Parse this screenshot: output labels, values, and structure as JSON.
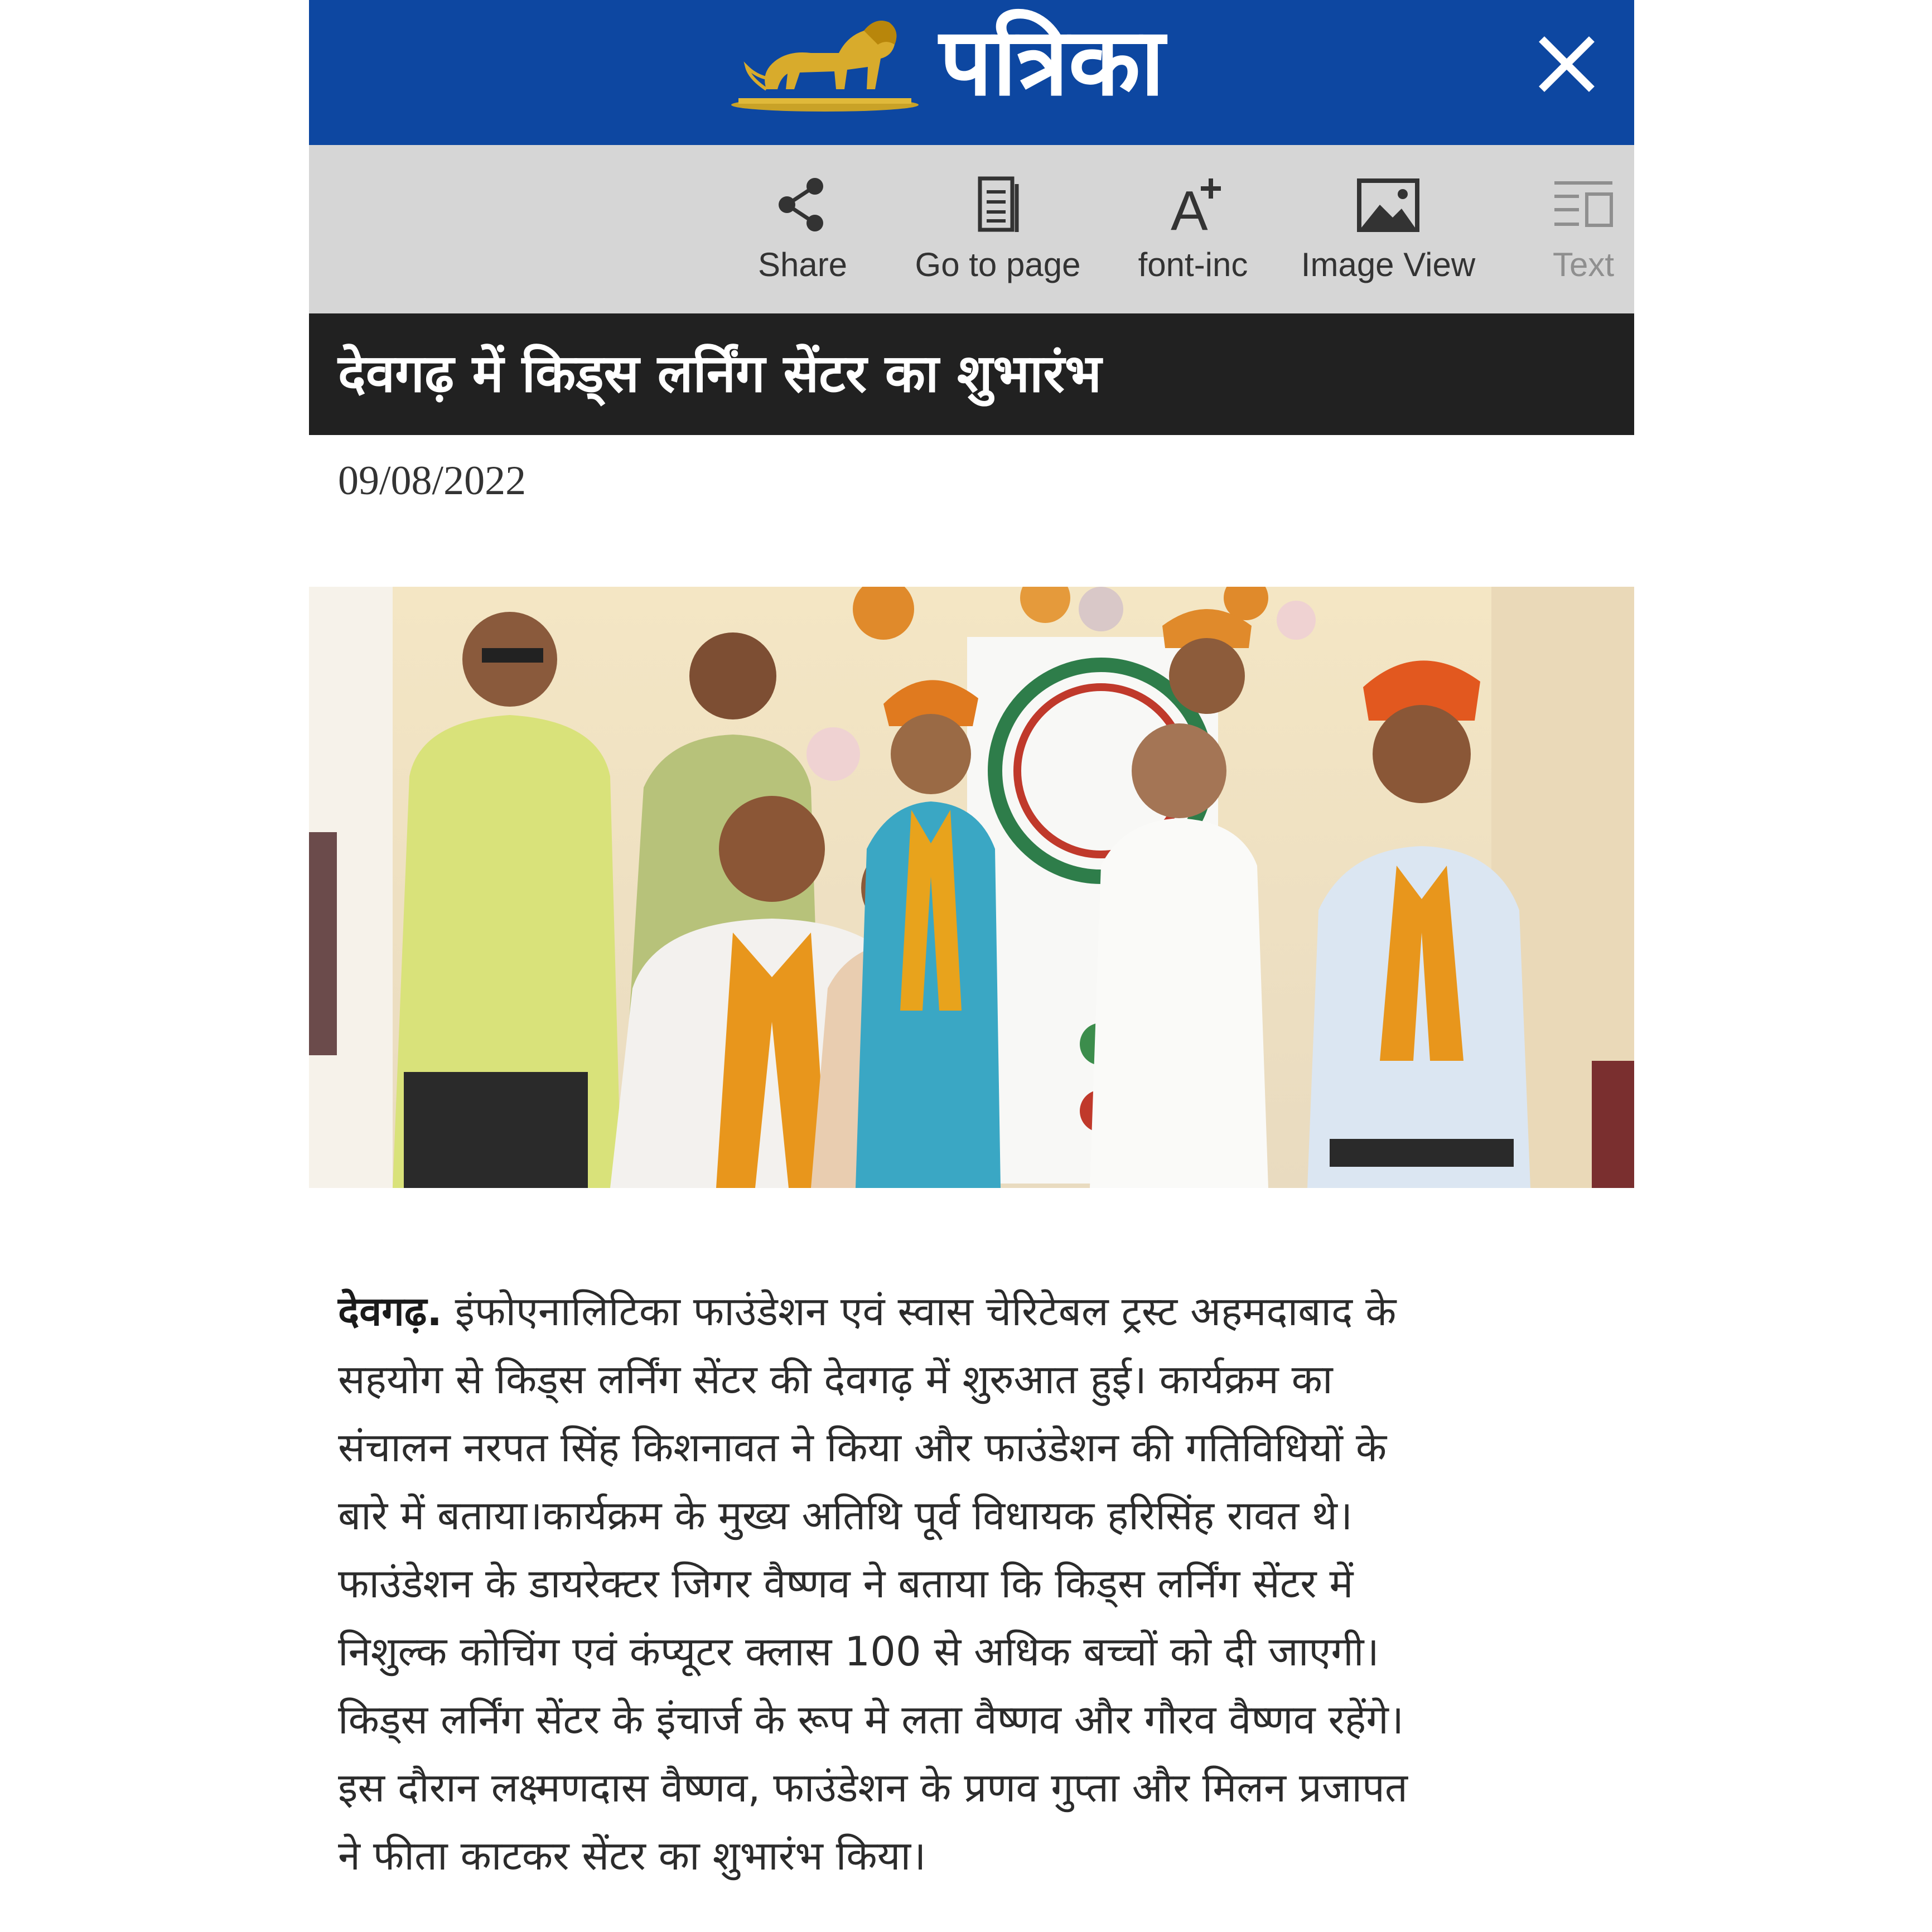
{
  "masthead": {
    "logo_text": "पत्रिका",
    "logo_mark_icon": "lion-icon",
    "close_icon": "close-icon",
    "bg_color": "#0d47a1"
  },
  "toolbar": {
    "items": [
      {
        "label": "Share",
        "icon": "share-icon",
        "enabled": true
      },
      {
        "label": "Go to page",
        "icon": "page-icon",
        "enabled": true
      },
      {
        "label": "font-inc",
        "icon": "font-increase-icon",
        "enabled": true
      },
      {
        "label": "Image View",
        "icon": "image-icon",
        "enabled": true
      },
      {
        "label": "Text",
        "icon": "text-view-icon",
        "enabled": false
      }
    ]
  },
  "article": {
    "headline": "देवगढ़ में किड्स लर्निंग सेंटर का शुभारंभ",
    "date": "09/08/2022",
    "dateline": "देवगढ़.",
    "body_lines": [
      "इंफोएनालिटिका फाउंडेशन एवं स्वास चेरिटेबल ट्रस्ट अहमदाबाद के",
      "सहयोग से किड्स लर्निंग सेंटर की देवगढ़ में शुरुआत हुई। कार्यक्रम का",
      "संचालन नरपत सिंह किशनावत ने किया और फाउंडेशन की गतिविधियों के",
      "बारे में बताया।कार्यक्रम के मुख्य अतिथि पूर्व विधायक हरिसिंह रावत थे।",
      "फाउंडेशन के डायरेक्टर जिगर वैष्णव ने बताया कि किड्स लर्निंग सेंटर में",
      "निशुल्क कोचिंग एवं कंप्यूटर क्लास 100 से अधिक बच्चों को दी जाएगी।",
      "किड्स लर्निंग सेंटर के इंचार्ज के रूप मे लता वैष्णव और गौरव वैष्णव रहेंगे।",
      "इस दौरान लक्ष्मणदास वैष्णव, फाउंडेशन के प्रणव गुप्ता और मिलन प्रजापत",
      "ने फीता काटकर सेंटर का शुभारंभ किया।"
    ]
  }
}
